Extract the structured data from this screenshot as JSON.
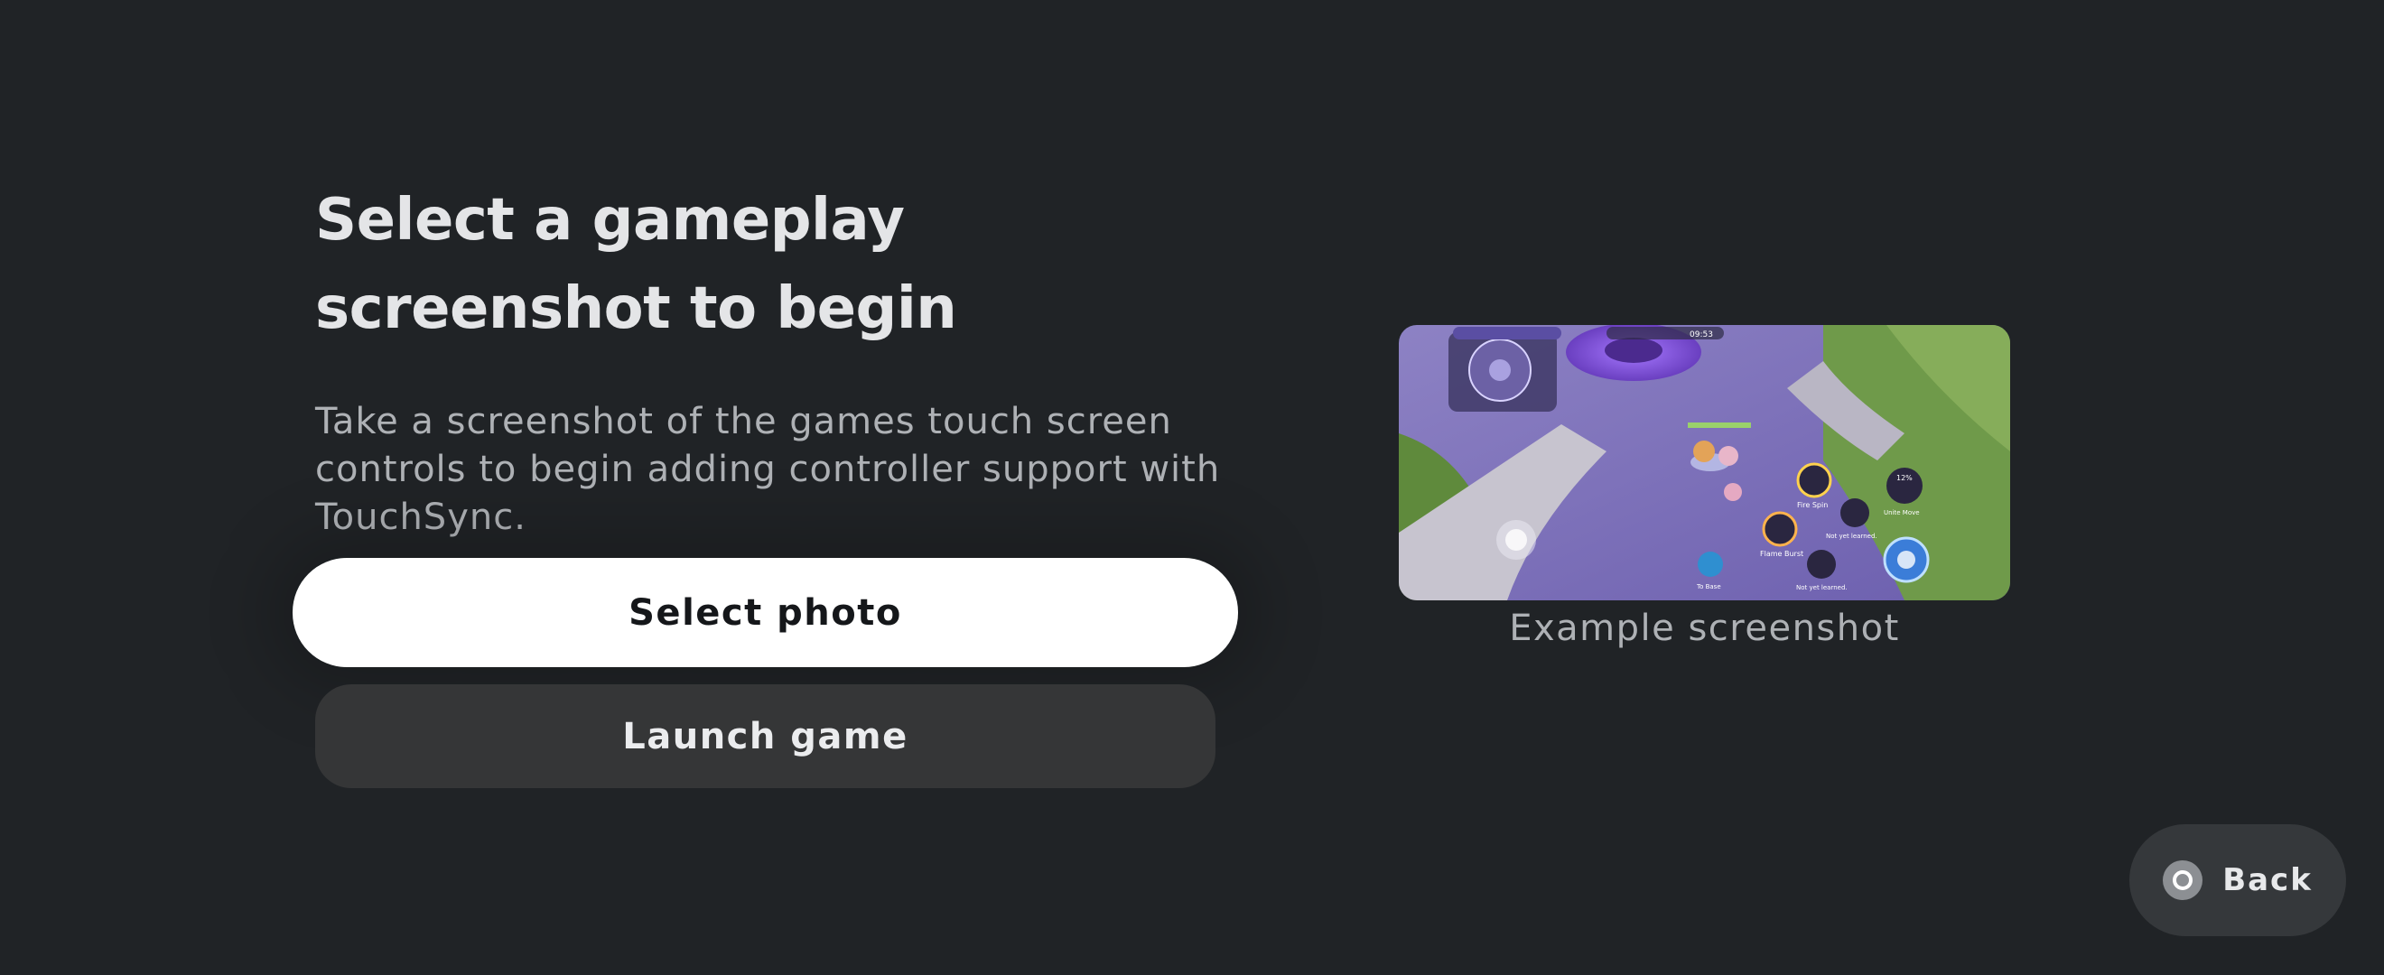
{
  "onboarding": {
    "title": "Select a gameplay screenshot to begin",
    "description": "Take a screenshot of the games touch screen controls to begin adding controller support with TouchSync."
  },
  "actions": {
    "select_photo_label": "Select photo",
    "launch_game_label": "Launch game"
  },
  "example": {
    "caption": "Example screenshot",
    "image_icon": "game-screenshot-thumbnail",
    "hud_text": {
      "timer": "09:53",
      "skill_1": "Fire Spin",
      "skill_2": "Flame Burst",
      "unite": "Unite Move",
      "unlearned_1": "Not yet learned.",
      "unlearned_2": "Not yet learned.",
      "to_base": "To Base",
      "unite_percent": "12%"
    }
  },
  "navigation": {
    "back_label": "Back",
    "back_icon": "circle-button-icon"
  },
  "colors": {
    "background": "#202326",
    "primary_button": "#ffffff",
    "secondary_button": "#353637",
    "back_button": "#35383b"
  }
}
